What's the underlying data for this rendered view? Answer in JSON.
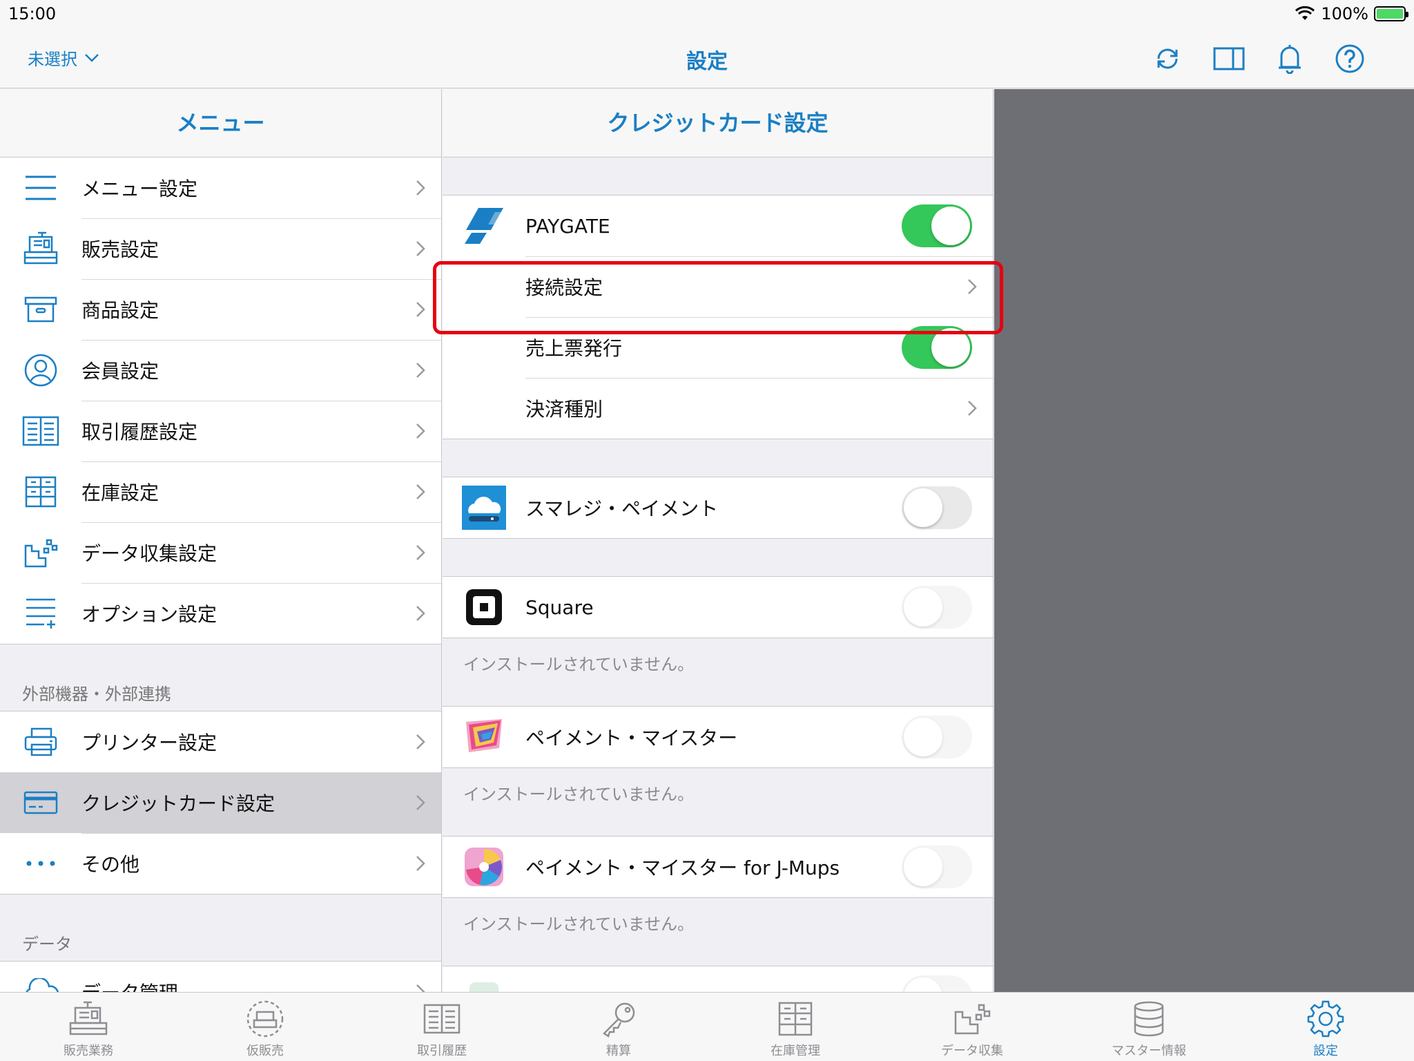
{
  "status_bar": {
    "time": "15:00",
    "battery": "100%"
  },
  "nav": {
    "store_select": "未選択",
    "title": "設定",
    "icons": [
      "refresh-icon",
      "split-view-icon",
      "bell-icon",
      "help-icon"
    ]
  },
  "menu": {
    "header": "メニュー",
    "items": [
      {
        "label": "メニュー設定",
        "icon": "list-icon"
      },
      {
        "label": "販売設定",
        "icon": "register-icon"
      },
      {
        "label": "商品設定",
        "icon": "box-icon"
      },
      {
        "label": "会員設定",
        "icon": "person-icon"
      },
      {
        "label": "取引履歴設定",
        "icon": "ledger-icon"
      },
      {
        "label": "在庫設定",
        "icon": "shelf-icon"
      },
      {
        "label": "データ収集設定",
        "icon": "data-icon"
      },
      {
        "label": "オプション設定",
        "icon": "list-plus-icon"
      }
    ],
    "section_external": "外部機器・外部連携",
    "external_items": [
      {
        "label": "プリンター設定",
        "icon": "printer-icon"
      },
      {
        "label": "クレジットカード設定",
        "icon": "card-icon",
        "selected": true
      },
      {
        "label": "その他",
        "icon": "more-icon"
      }
    ],
    "section_data": "データ",
    "data_items": [
      {
        "label": "データ管理",
        "icon": "cloud-icon"
      }
    ]
  },
  "detail": {
    "header": "クレジットカード設定",
    "paygate": {
      "label": "PAYGATE",
      "enabled": true,
      "connection": "接続設定",
      "receipt": "売上票発行",
      "receipt_enabled": true,
      "payment_type": "決済種別"
    },
    "providers": [
      {
        "label": "スマレジ・ペイメント",
        "enabled": false,
        "note": ""
      },
      {
        "label": "Square",
        "enabled": false,
        "note": "インストールされていません。"
      },
      {
        "label": "ペイメント・マイスター",
        "enabled": false,
        "note": "インストールされていません。"
      },
      {
        "label": "ペイメント・マイスター for J-Mups",
        "enabled": false,
        "note": "インストールされていません。"
      }
    ]
  },
  "tabs": [
    {
      "label": "販売業務",
      "icon": "register-icon"
    },
    {
      "label": "仮販売",
      "icon": "temp-sale-icon"
    },
    {
      "label": "取引履歴",
      "icon": "ledger-icon"
    },
    {
      "label": "精算",
      "icon": "key-icon"
    },
    {
      "label": "在庫管理",
      "icon": "shelf-icon"
    },
    {
      "label": "データ収集",
      "icon": "data-icon"
    },
    {
      "label": "マスター情報",
      "icon": "database-icon"
    },
    {
      "label": "設定",
      "icon": "gear-icon",
      "active": true
    }
  ],
  "colors": {
    "accent": "#1a7fc4",
    "toggle_on": "#34c759",
    "highlight": "#e60012",
    "side_panel": "#6e6f75"
  }
}
